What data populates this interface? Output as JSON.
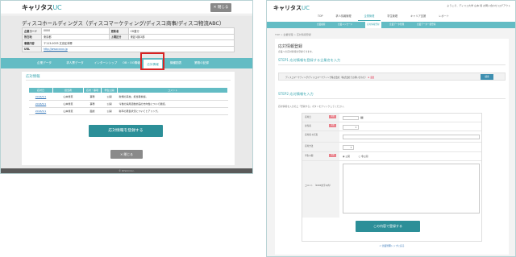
{
  "left": {
    "logo_main": "キャリタス",
    "logo_suffix": "UC",
    "close_label": "閉じる",
    "company_name": "ディスコホールディングス（ディスコマーケティング/ディスコ商事/ディスコ物流ABC）",
    "info_rows": [
      {
        "label": "企業コード",
        "value": "0000",
        "label2": "更新者",
        "value2": "CD直行"
      },
      {
        "label": "所在地",
        "value": "東京都",
        "label2": "上場区分",
        "value2": "東証1部/2部"
      },
      {
        "label": "事業内容",
        "value": "〒113-0033 文京区本郷",
        "label2": "",
        "value2": ""
      },
      {
        "label": "URL",
        "value": "http://www.xxxx.jp",
        "label2": "",
        "value2": ""
      }
    ],
    "tabs": [
      "企業データ",
      "求人票データ",
      "インターンシップ",
      "OB・OG情報",
      "応対情報",
      "機種図表",
      "業務の記録"
    ],
    "active_tab_index": 4,
    "section_title": "応対情報",
    "table_headers": [
      "応対日",
      "担当者",
      "応対・事項",
      "学生公開",
      "コメント"
    ],
    "table_rows": [
      {
        "date": "2018/5/1",
        "staff": "山本秀恵",
        "kind": "事務",
        "pub": "公開",
        "comment": "新規の来校。担当者挨拶。"
      },
      {
        "date": "2018/5/1",
        "staff": "山本秀恵",
        "kind": "事務",
        "pub": "公開",
        "comment": "今後の採用活動計画の方向性について確認。"
      },
      {
        "date": "2018/5/1",
        "staff": "山本秀恵",
        "kind": "面談",
        "pub": "公開",
        "comment": "新卒の募集状況についてヒアリング。"
      }
    ],
    "register_label": "応対情報を登録する",
    "back_label": "閉じる",
    "footer": "© DISCO Inc."
  },
  "right": {
    "logo_main": "キャリタス",
    "logo_suffix": "UC",
    "user_info": "ようこそ、ディスコ大学 山本 様   お問い合わせ   ログアウト",
    "nav": [
      "TOP",
      "求人情報管理",
      "企業管理",
      "学生管理",
      "キャリア支援",
      "レポート"
    ],
    "active_nav_index": 2,
    "subnav": [
      "企業検索",
      "企業メッセージ",
      "応対情報登録",
      "企業データ管理",
      "企業データ一括登録",
      "公開データ公開チェック"
    ],
    "active_sub_index": 2,
    "breadcrumb": "TOP > 企業管理 > 応対情報登録",
    "page_title": "応対情報登録",
    "page_desc": "企業への応対情報を登録できます。",
    "step1": "STEP1   応対情報を登録する企業名を入力",
    "step1_company": "ディスコマーケティング/ディスコマーケティング株式会社（株式会社でお問い合わせ）",
    "step1_flag": "※ 変更",
    "step1_button": "検索",
    "step2": "STEP2   応対情報を入力",
    "step2_desc": "応対情報を入力の上「登録する」ボタンをクリックしてください。",
    "fields": [
      "応対日",
      "担当者",
      "応対者\nの氏名",
      "応対方法",
      "学生公開",
      "コメント\n（1000文字以内）"
    ],
    "required_tag": "必須",
    "radio_labels": [
      "公開",
      "非公開"
    ],
    "submit_label": "この内容で登録する",
    "back_link": "< 企業管理トップに戻る"
  }
}
